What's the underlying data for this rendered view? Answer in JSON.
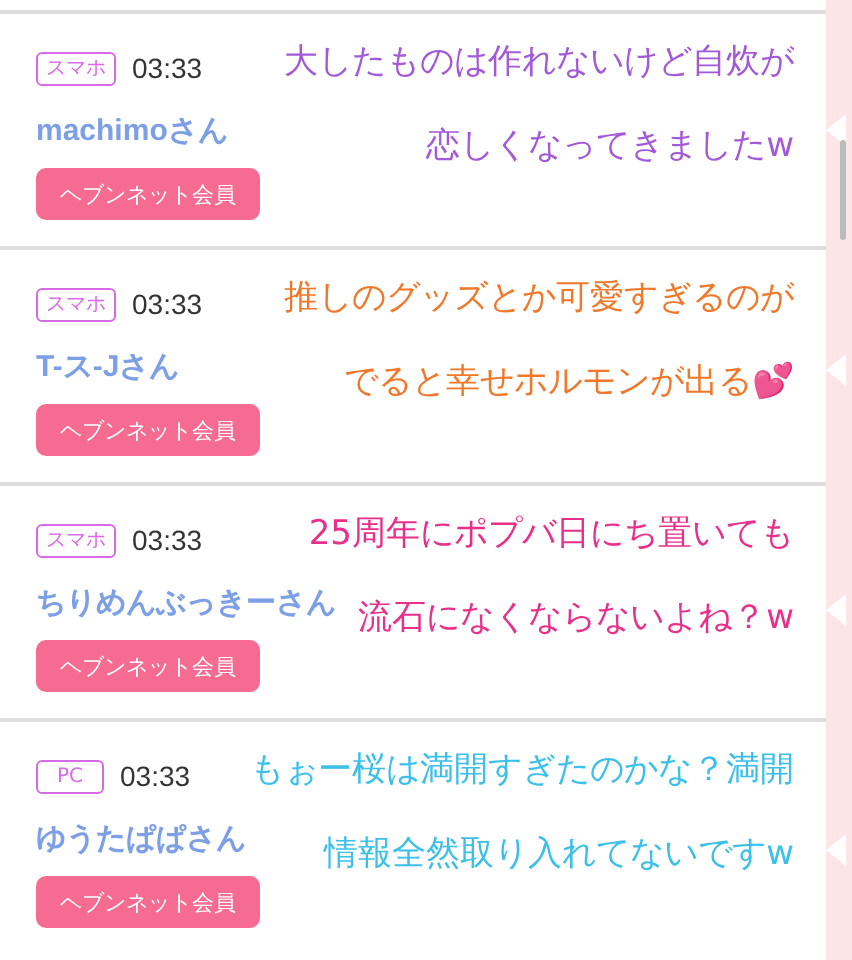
{
  "posts": [
    {
      "badge": "スマホ",
      "time": "03:33",
      "name": "machimoさん",
      "member_button": "ヘブンネット会員",
      "caption": {
        "color": "#a35ad8",
        "lines": [
          "大したものは作れないけど自炊が",
          "恋しくなってきましたw"
        ]
      }
    },
    {
      "badge": "スマホ",
      "time": "03:33",
      "name": "T-ス-Jさん",
      "member_button": "ヘブンネット会員",
      "caption": {
        "color": "#f0782a",
        "lines": [
          "推しのグッズとか可愛すぎるのが",
          "でると幸せホルモンが出る💕"
        ]
      }
    },
    {
      "badge": "スマホ",
      "time": "03:33",
      "name": "ちりめんぶっきーさん",
      "member_button": "ヘブンネット会員",
      "caption": {
        "color": "#e8308a",
        "lines": [
          "25周年にポプバ日にち置いても",
          "流石になくならないよね？w"
        ]
      }
    },
    {
      "badge": "PC",
      "time": "03:33",
      "name": "ゆうたぱぱさん",
      "member_button": "ヘブンネット会員",
      "caption": {
        "color": "#3cc0ea",
        "lines": [
          "もぉー桜は満開すぎたのかな？満開",
          "情報全然取り入れてないですw"
        ]
      }
    }
  ]
}
